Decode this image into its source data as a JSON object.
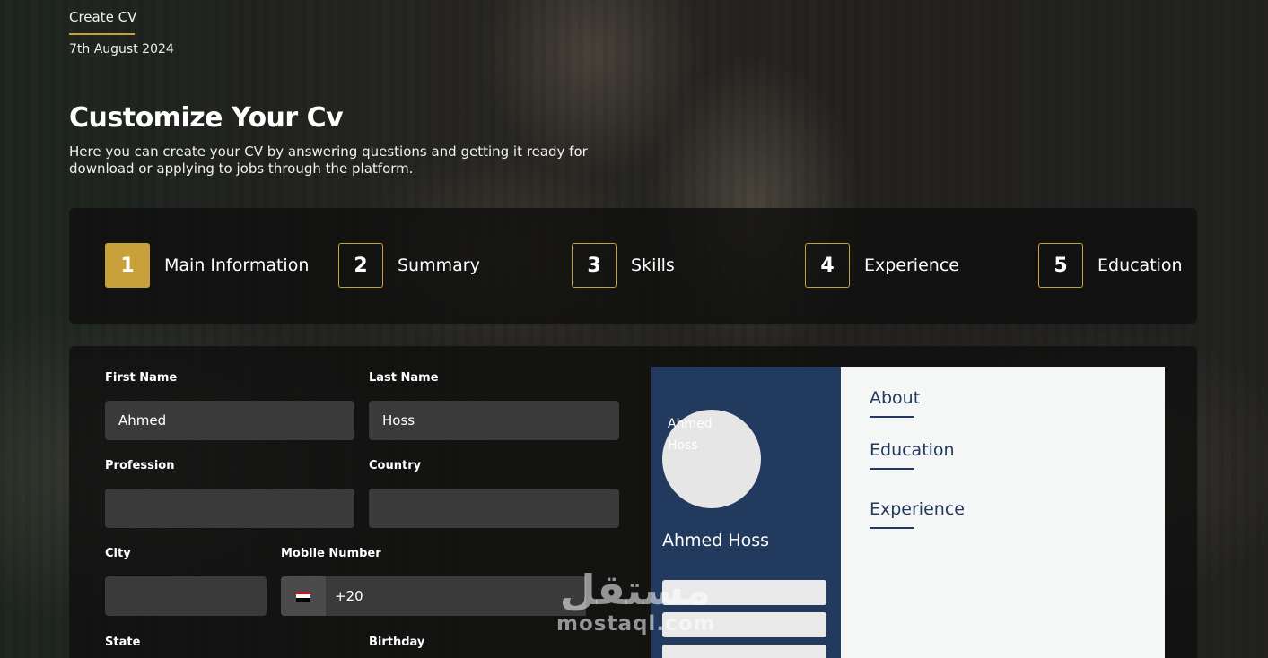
{
  "header": {
    "breadcrumb": "Create CV",
    "date": "7th August 2024",
    "title": "Customize Your Cv",
    "description": "Here you can create your CV by answering questions and getting it ready for download or applying to jobs through the platform."
  },
  "steps": [
    {
      "number": "1",
      "label": "Main Information",
      "active": true
    },
    {
      "number": "2",
      "label": "Summary",
      "active": false
    },
    {
      "number": "3",
      "label": "Skills",
      "active": false
    },
    {
      "number": "4",
      "label": "Experience",
      "active": false
    },
    {
      "number": "5",
      "label": "Education",
      "active": false
    }
  ],
  "form": {
    "first_name": {
      "label": "First Name",
      "value": "Ahmed"
    },
    "last_name": {
      "label": "Last Name",
      "value": "Hoss"
    },
    "profession": {
      "label": "Profession",
      "value": ""
    },
    "country": {
      "label": "Country",
      "value": ""
    },
    "city": {
      "label": "City",
      "value": ""
    },
    "mobile": {
      "label": "Mobile Number",
      "code": "+20",
      "flag": "egypt-flag-icon"
    },
    "state": {
      "label": "State"
    },
    "birthday": {
      "label": "Birthday"
    }
  },
  "preview": {
    "avatar_alt": "Ahmed Hoss",
    "name": "Ahmed Hoss",
    "sections": [
      "About",
      "Education",
      "Experience"
    ]
  },
  "watermark": {
    "arabic": "مستقل",
    "latin": "mostaql.com"
  },
  "colors": {
    "accent": "#c9a13b",
    "preview_sidebar": "#223a5e",
    "panel": "#0e0e0e"
  }
}
